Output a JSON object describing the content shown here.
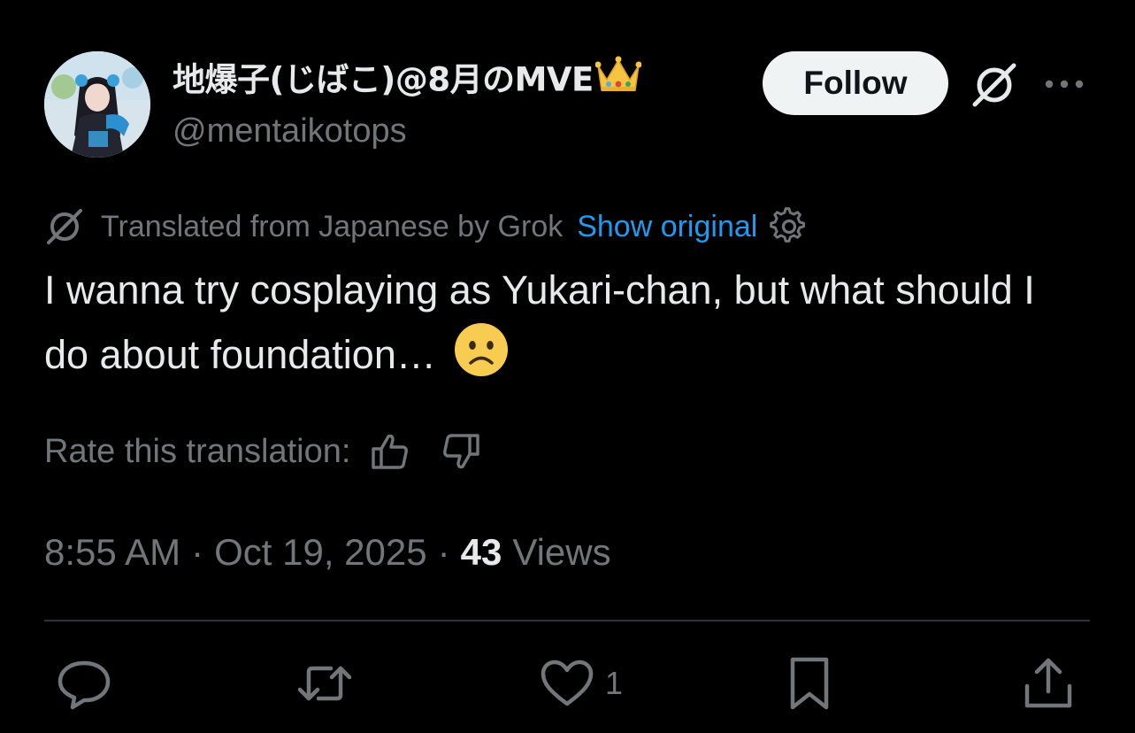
{
  "author": {
    "display_name": "地爆子(じばこ)@8月のMVE",
    "handle": "@mentaikotops"
  },
  "header": {
    "follow_label": "Follow"
  },
  "translation": {
    "notice": "Translated from Japanese by Grok",
    "show_original_label": "Show original"
  },
  "tweet": {
    "text": "I wanna try cosplaying as Yukari-chan, but what should I do about foundation…"
  },
  "rate": {
    "label": "Rate this translation:"
  },
  "meta": {
    "time": "8:55 AM",
    "sep1": "·",
    "date": "Oct 19, 2025",
    "sep2": "·",
    "views_count": "43",
    "views_label": "Views"
  },
  "actions": {
    "like_count": "1"
  },
  "colors": {
    "background": "#000000",
    "text_primary": "#e7e9ea",
    "text_secondary": "#71767b",
    "link": "#1d9bf0",
    "follow_bg": "#eff3f4",
    "divider": "#2f3336"
  },
  "icons": [
    "grok-icon",
    "more-icon",
    "gear-icon",
    "thumbs-up-icon",
    "thumbs-down-icon",
    "reply-icon",
    "repost-icon",
    "heart-icon",
    "bookmark-icon",
    "share-icon",
    "crown-emoji",
    "frowning-face-emoji"
  ]
}
